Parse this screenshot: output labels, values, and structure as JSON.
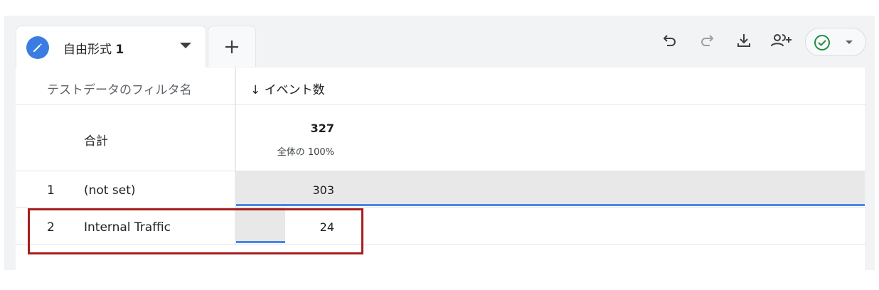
{
  "tabs": {
    "active": {
      "label": "自由形式",
      "number": "1",
      "icon": "pencil-icon"
    },
    "add_icon": "plus-icon"
  },
  "toolbar": {
    "icons": [
      "undo-icon",
      "redo-icon",
      "download-icon",
      "share-users-icon"
    ],
    "status_icon": "check-circle-icon",
    "colors": {
      "accent": "#3b7ce3",
      "check": "#1e8e3e",
      "highlight": "#a71d1d",
      "bar_line": "#4a86e8"
    }
  },
  "table": {
    "header": {
      "dimension": "テストデータのフィルタ名",
      "metric_arrow": "↓",
      "metric": "イベント数"
    },
    "total": {
      "label": "合計",
      "value": "327",
      "percent": "全体の 100%"
    },
    "rows": [
      {
        "index": "1",
        "name": "(not set)",
        "value": "303",
        "share": 0.927
      },
      {
        "index": "2",
        "name": "Internal Traffic",
        "value": "24",
        "share": 0.073
      }
    ]
  }
}
